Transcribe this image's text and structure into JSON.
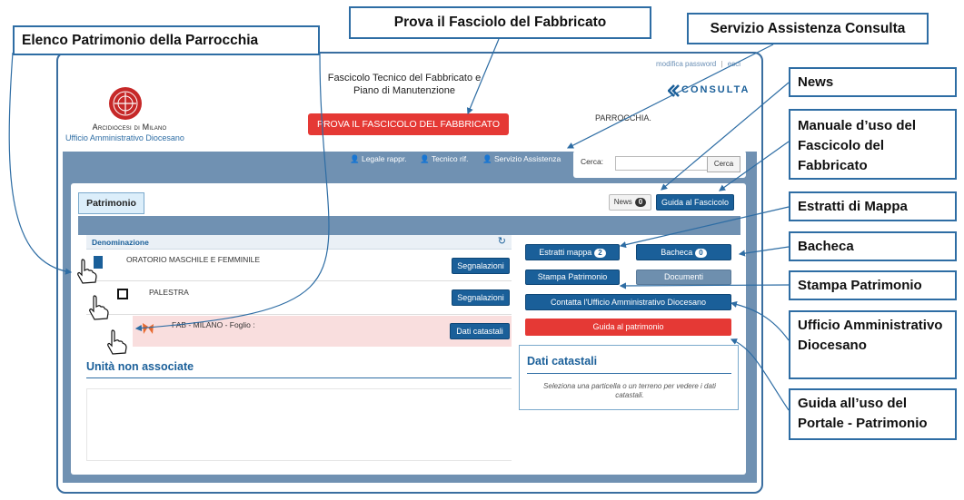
{
  "callouts": {
    "elenco": "Elenco Patrimonio della Parrocchia",
    "prova": "Prova il Fasciolo del Fabbricato",
    "servizio": "Servizio Assistenza Consulta",
    "news": "News",
    "manuale": "Manuale d’uso del Fascicolo del Fabbricato",
    "estratti": "Estratti di Mappa",
    "bacheca": "Bacheca",
    "stampa": "Stampa Patrimonio",
    "ufficio": "Ufficio Amministrativo Diocesano",
    "guida": "Guida all’uso del Portale - Patrimonio"
  },
  "header": {
    "diocese_name": "Arcidiocesi di Milano",
    "office": "Ufficio Amministrativo Diocesano",
    "title_line1": "Fascicolo Tecnico del Fabbricato e",
    "title_line2": "Piano di Manutenzione",
    "cta": "PROVA IL FASCICOLO DEL FABBRICATO",
    "parrocchia": "PARROCCHIA.",
    "modifica_password": "modifica password",
    "esci": "esci",
    "brand": "CONSULTA"
  },
  "nav": {
    "legale": "Legale rappr.",
    "tecnico": "Tecnico rif.",
    "servizio": "Servizio Assistenza",
    "cerca_label": "Cerca:",
    "cerca_button": "Cerca",
    "cerca_value": ""
  },
  "tabs": {
    "patrimonio": "Patrimonio",
    "news": "News",
    "news_count": "0",
    "guida_fascicolo": "Guida al Fascicolo"
  },
  "list": {
    "header": "Denominazione",
    "rows": [
      {
        "name": "ORATORIO MASCHILE E FEMMINILE",
        "action": "Segnalazioni"
      },
      {
        "name": "PALESTRA",
        "action": "Segnalazioni"
      },
      {
        "name": "FAB - MILANO - Foglio :",
        "action": "Dati catastali"
      }
    ],
    "unassigned_title": "Unità non associate"
  },
  "side": {
    "estratti": "Estratti mappa",
    "estratti_count": "2",
    "bacheca": "Bacheca",
    "bacheca_count": "0",
    "stampa": "Stampa Patrimonio",
    "documenti": "Documenti",
    "contatta": "Contatta l'Ufficio Amministrativo Diocesano",
    "guida": "Guida al patrimonio",
    "dati_title": "Dati catastali",
    "dati_hint": "Seleziona una particella o un terreno per vedere i dati catastali."
  },
  "colors": {
    "primary": "#1a5f99",
    "danger": "#e53935",
    "band": "#7091b2",
    "highlight_row": "#f9dede",
    "callout_border": "#2e6da4"
  }
}
